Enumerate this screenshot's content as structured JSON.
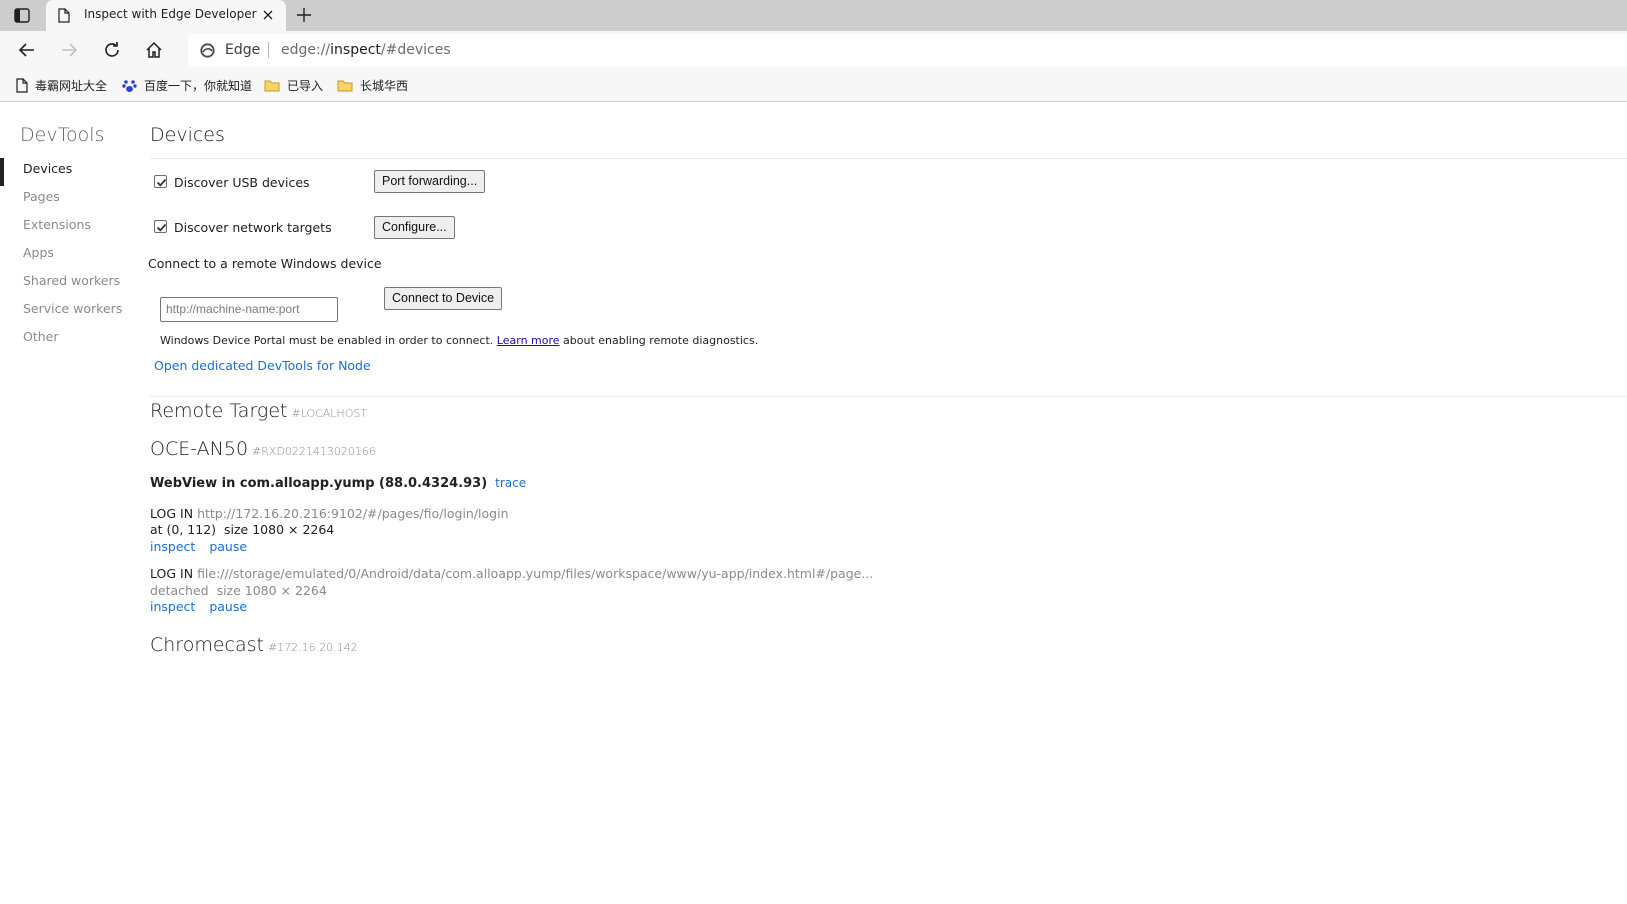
{
  "tab": {
    "title": "Inspect with Edge Developer Tools"
  },
  "toolbar": {
    "site_name": "Edge",
    "url_scheme": "edge://",
    "url_host": "inspect",
    "url_path": "/#devices"
  },
  "bookmarks": [
    {
      "label": "毒霸网址大全",
      "icon": "page-icon"
    },
    {
      "label": "百度一下，你就知道",
      "icon": "baidu-paw-icon"
    },
    {
      "label": "已导入",
      "icon": "folder-icon"
    },
    {
      "label": "长城华西",
      "icon": "folder-icon"
    }
  ],
  "sidebar": {
    "title": "DevTools",
    "items": [
      "Devices",
      "Pages",
      "Extensions",
      "Apps",
      "Shared workers",
      "Service workers",
      "Other"
    ],
    "active": "Devices"
  },
  "devices": {
    "heading": "Devices",
    "discover_usb": {
      "label": "Discover USB devices",
      "checked": true
    },
    "port_forwarding_button": "Port forwarding...",
    "discover_network": {
      "label": "Discover network targets",
      "checked": true
    },
    "configure_button": "Configure...",
    "remote_windows_label": "Connect to a remote Windows device",
    "remote_input_placeholder": "http://machine-name:port",
    "connect_button": "Connect to Device",
    "note_prefix": "Windows Device Portal must be enabled in order to connect.",
    "note_link": "Learn more",
    "note_suffix": "about enabling remote diagnostics.",
    "node_link": "Open dedicated DevTools for Node"
  },
  "remote_target": {
    "title": "Remote Target",
    "tag": "#LOCALHOST"
  },
  "device": {
    "name": "OCE-AN50",
    "serial": "#RXD0221413020166",
    "browser": "WebView in com.alloapp.yump (88.0.4324.93)",
    "trace_label": "trace",
    "pages": [
      {
        "title": "LOG IN",
        "url": "http://172.16.20.216:9102/#/pages/fio/login/login",
        "position": "at (0, 112)",
        "size": "size 1080 × 2264",
        "actions": [
          "inspect",
          "pause"
        ]
      },
      {
        "title": "LOG IN",
        "url": "file:///storage/emulated/0/Android/data/com.alloapp.yump/files/workspace/www/yu-app/index.html#/page...",
        "position": "detached",
        "size": "size 1080 × 2264",
        "actions": [
          "inspect",
          "pause"
        ]
      }
    ]
  },
  "chromecast": {
    "name": "Chromecast",
    "tag": "#172.16.20.142"
  }
}
